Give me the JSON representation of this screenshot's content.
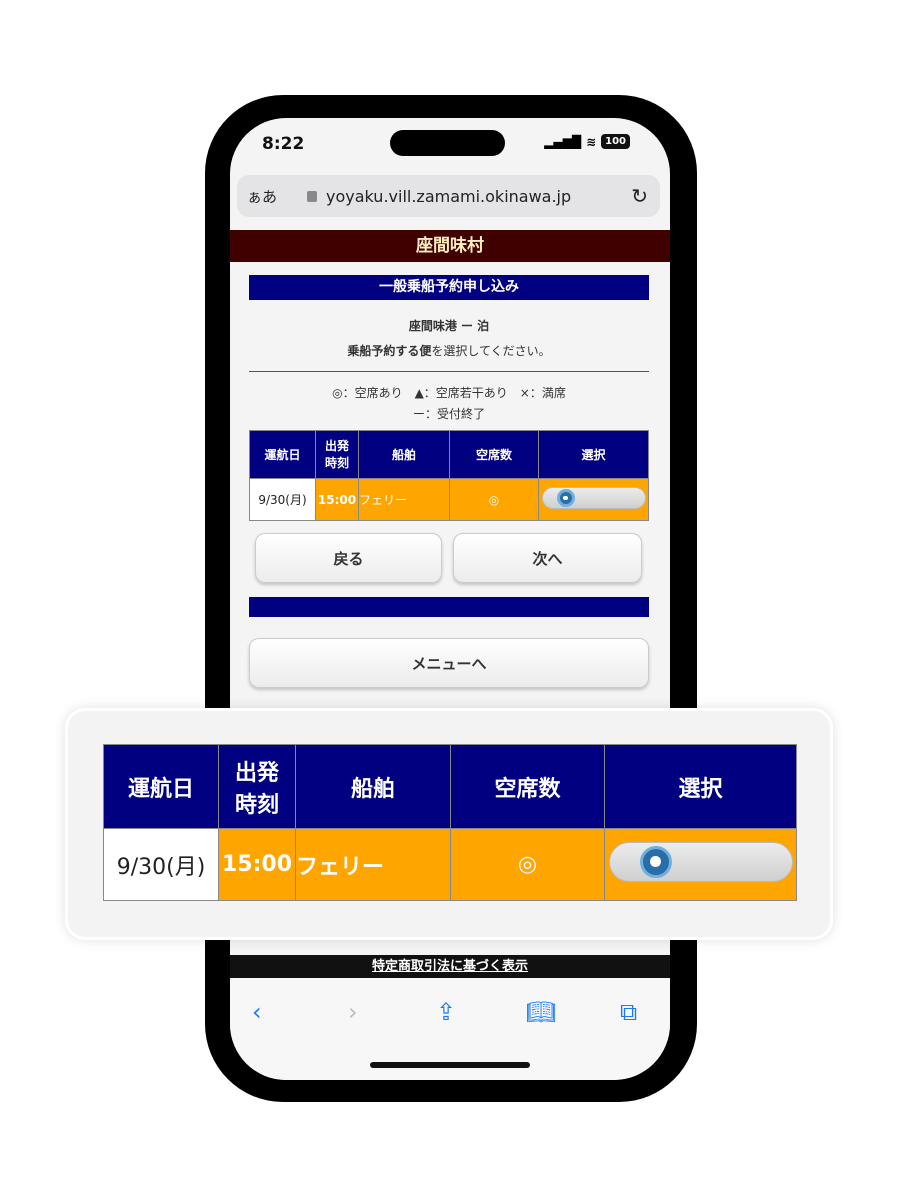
{
  "status": {
    "time": "8:22",
    "battery": "100"
  },
  "browser": {
    "text_size": "ぁあ",
    "url": "yoyaku.vill.zamami.okinawa.jp"
  },
  "site": {
    "title": "座間味村",
    "section": "一般乗船予約申し込み",
    "route": "座間味港 ー 泊",
    "instruction_bold": "乗船予約する便",
    "instruction_rest": "を選択してください。",
    "legend_line1": "◎：空席あり　▲：空席若干あり　×：満席",
    "legend_line2": "ー：受付終了"
  },
  "table": {
    "headers": [
      "運航日",
      "出発時刻",
      "船舶",
      "空席数",
      "選択"
    ],
    "header_time_1": "出発",
    "header_time_2": "時刻",
    "rows": [
      {
        "date": "9/30(月)",
        "time": "15:00",
        "ship": "フェリー",
        "seats": "◎",
        "selected": true
      }
    ]
  },
  "buttons": {
    "back": "戻る",
    "next": "次へ",
    "menu": "メニューへ"
  },
  "footer": {
    "link": "特定商取引法に基づく表示"
  },
  "colors": {
    "header_red": "#400000",
    "navy": "#000080",
    "orange": "#ffa500",
    "ios_blue": "#1a7cf5"
  },
  "toolbar": {
    "icons": [
      "back-icon",
      "forward-icon",
      "share-icon",
      "bookmarks-icon",
      "tabs-icon"
    ]
  }
}
